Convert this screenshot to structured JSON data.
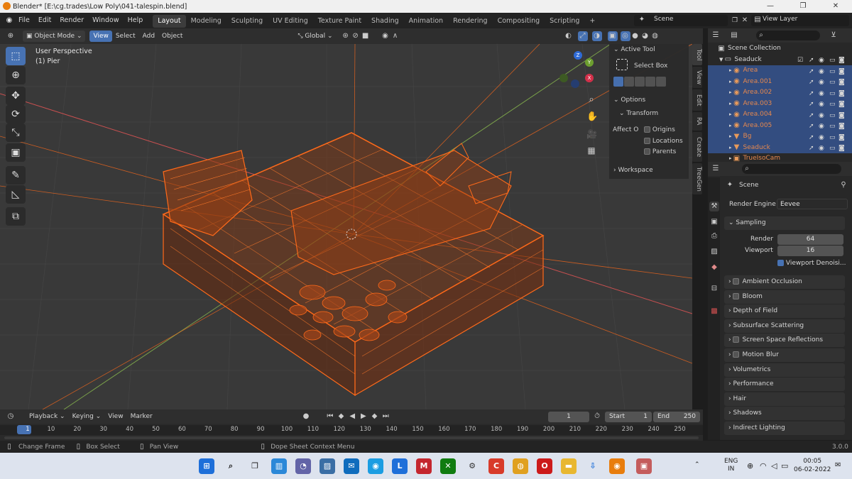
{
  "window": {
    "title": "Blender* [E:\\cg.trades\\Low Poly\\041-talespin.blend]"
  },
  "menubar": {
    "menus": [
      "File",
      "Edit",
      "Render",
      "Window",
      "Help"
    ],
    "workspaces": [
      "Layout",
      "Modeling",
      "Sculpting",
      "UV Editing",
      "Texture Paint",
      "Shading",
      "Animation",
      "Rendering",
      "Compositing",
      "Scripting"
    ],
    "add_tab": "+",
    "scene_label": "Scene",
    "view_layer_label": "View Layer"
  },
  "viewport_header": {
    "mode": "Object Mode",
    "menus": [
      "View",
      "Select",
      "Add",
      "Object"
    ],
    "orientation": "Global"
  },
  "viewport": {
    "perspective": "User Perspective",
    "object": "(1) Pier",
    "gizmo_axes": [
      "Z",
      "Y",
      "X"
    ]
  },
  "npanel": {
    "active_tool_header": "Active Tool",
    "tool_name": "Select Box",
    "options_header": "Options",
    "transform_header": "Transform",
    "affect_label": "Affect O",
    "affect_options": [
      "Origins",
      "Locations",
      "Parents"
    ],
    "workspace_header": "Workspace",
    "tabs": [
      "Tool",
      "View",
      "Edit",
      "RA",
      "Create",
      "TreeGen"
    ]
  },
  "outliner": {
    "root": "Scene Collection",
    "collection": "Seaduck",
    "items": [
      "Area",
      "Area.001",
      "Area.002",
      "Area.003",
      "Area.004",
      "Area.005",
      "Bg",
      "Seaduck",
      "TrueIsoCam"
    ]
  },
  "properties": {
    "scene_name": "Scene",
    "render_engine_label": "Render Engine",
    "render_engine": "Eevee",
    "sampling_header": "Sampling",
    "render_label": "Render",
    "render_value": "64",
    "viewport_label": "Viewport",
    "viewport_value": "16",
    "denoise_label": "Viewport Denoisi...",
    "sections": [
      "Ambient Occlusion",
      "Bloom",
      "Depth of Field",
      "Subsurface Scattering",
      "Screen Space Reflections",
      "Motion Blur",
      "Volumetrics",
      "Performance",
      "Hair",
      "Shadows",
      "Indirect Lighting"
    ],
    "checkbox_sections": [
      "Ambient Occlusion",
      "Bloom",
      "Screen Space Reflections",
      "Motion Blur"
    ]
  },
  "timeline": {
    "menus": [
      "Playback",
      "Keying",
      "View",
      "Marker"
    ],
    "current_frame": "1",
    "start_label": "Start",
    "start_value": "1",
    "end_label": "End",
    "end_value": "250",
    "ticks": [
      "1",
      "10",
      "20",
      "30",
      "40",
      "50",
      "60",
      "70",
      "80",
      "90",
      "100",
      "110",
      "120",
      "130",
      "140",
      "150",
      "160",
      "170",
      "180",
      "190",
      "200",
      "210",
      "220",
      "230",
      "240",
      "250"
    ]
  },
  "statusbar": {
    "items": [
      "Change Frame",
      "Box Select",
      "Pan View",
      "Dope Sheet Context Menu"
    ],
    "version": "3.0.0"
  },
  "taskbar": {
    "lang_top": "ENG",
    "lang_bottom": "IN",
    "time": "00:05",
    "date": "06-02-2022"
  },
  "colors": {
    "accent": "#4772b3",
    "wire": "#ff6a1a",
    "viewport_bg": "#393939",
    "selection": "#334d80"
  }
}
